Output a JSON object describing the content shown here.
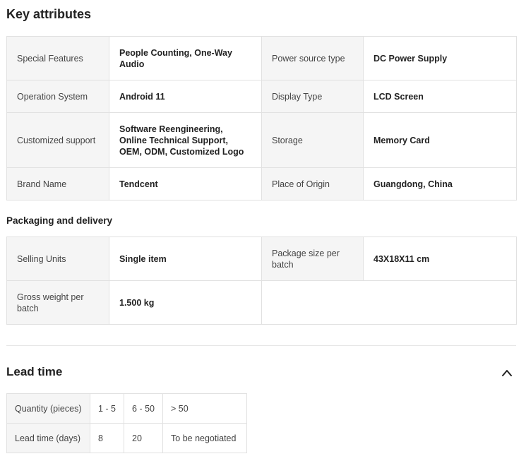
{
  "key_attributes": {
    "title": "Key attributes",
    "rows": [
      [
        {
          "label": "Special Features",
          "value": "People Counting, One-Way Audio"
        },
        {
          "label": "Power source type",
          "value": "DC Power Supply"
        }
      ],
      [
        {
          "label": "Operation System",
          "value": "Android 11"
        },
        {
          "label": "Display Type",
          "value": "LCD Screen"
        }
      ],
      [
        {
          "label": "Customized support",
          "value": "Software Reengineering, Online Technical Support, OEM, ODM, Customized Logo"
        },
        {
          "label": "Storage",
          "value": "Memory Card"
        }
      ],
      [
        {
          "label": "Brand Name",
          "value": "Tendcent"
        },
        {
          "label": "Place of Origin",
          "value": "Guangdong, China"
        }
      ]
    ]
  },
  "packaging": {
    "title": "Packaging and delivery",
    "rows": [
      [
        {
          "label": "Selling Units",
          "value": "Single item"
        },
        {
          "label": "Package size per batch",
          "value": "43X18X11 cm"
        }
      ],
      [
        {
          "label": "Gross weight per batch",
          "value": "1.500 kg"
        }
      ]
    ]
  },
  "lead_time": {
    "title": "Lead time",
    "toggle_icon": "chevron-up-icon",
    "quantity_label": "Quantity (pieces)",
    "quantities": [
      "1 - 5",
      "6 - 50",
      "> 50"
    ],
    "days_label": "Lead time (days)",
    "days": [
      "8",
      "20",
      "To be negotiated"
    ]
  }
}
